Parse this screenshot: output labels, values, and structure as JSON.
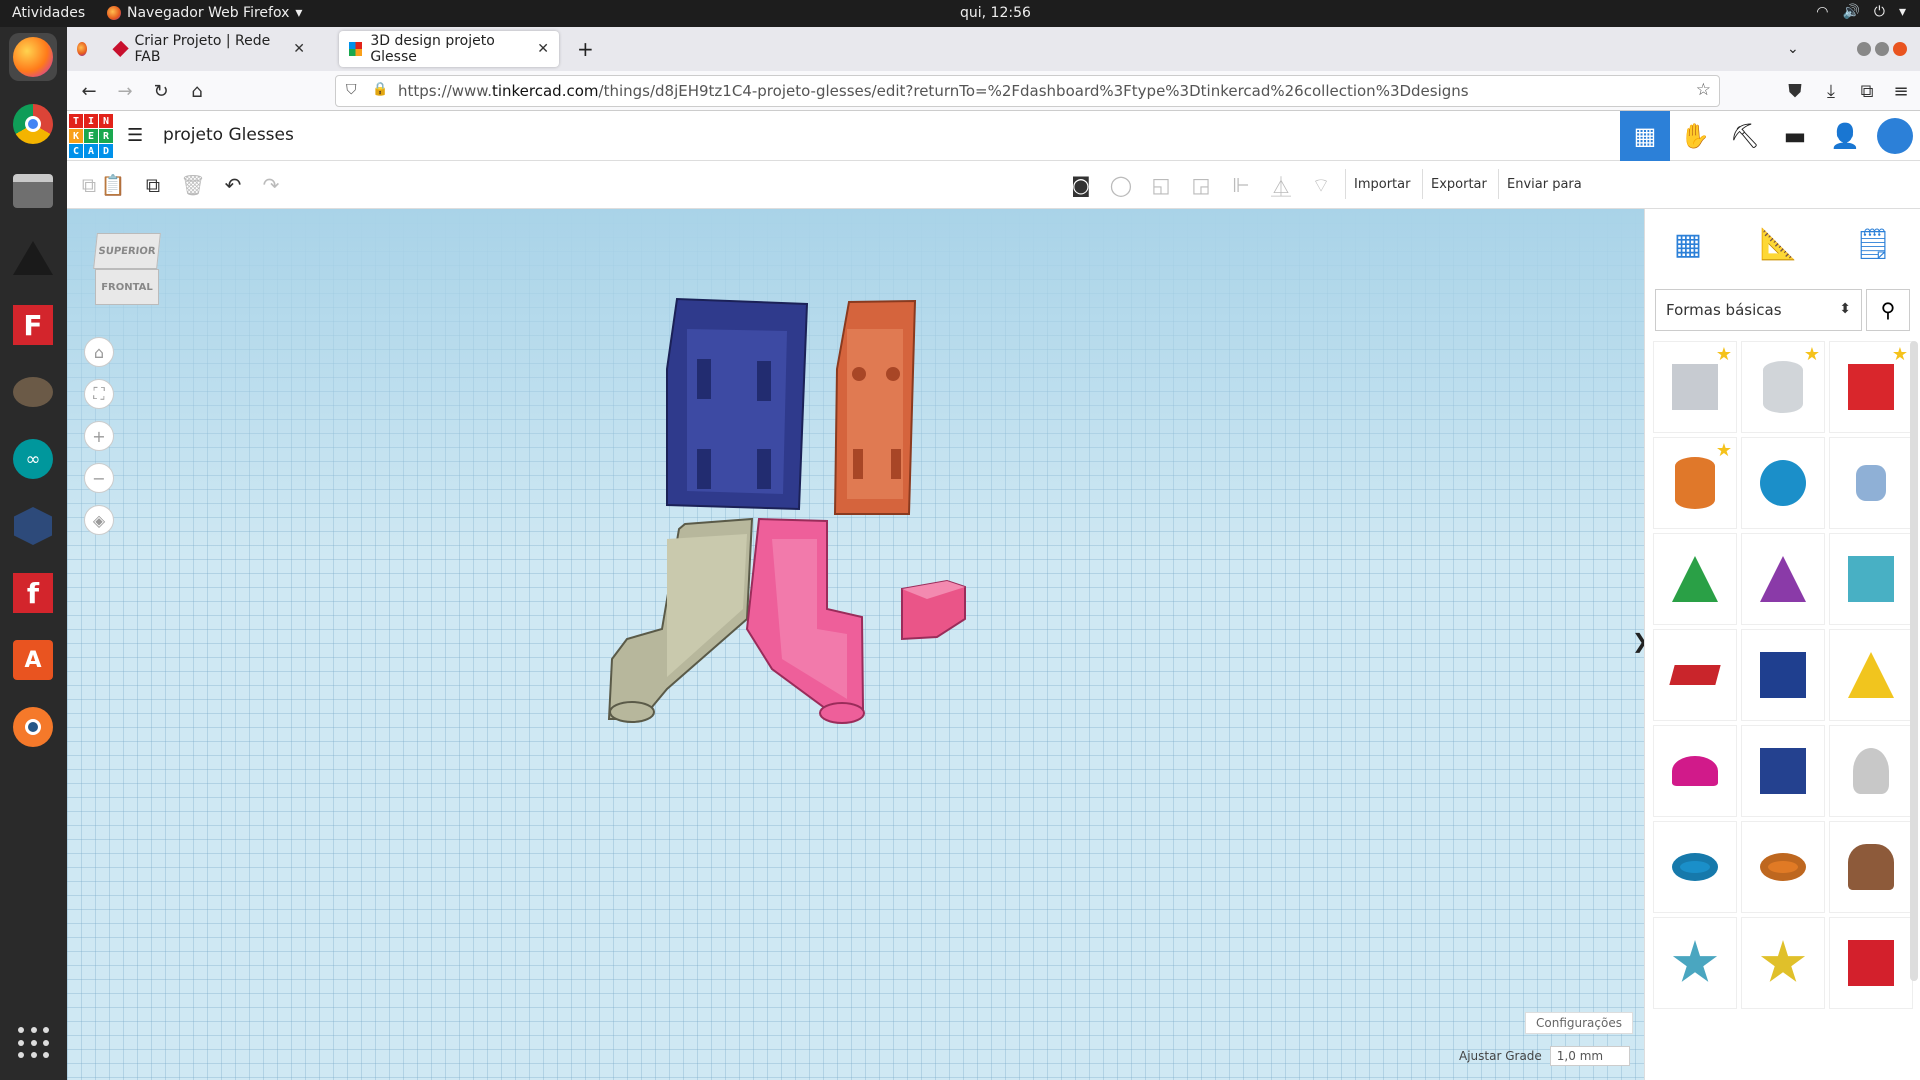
{
  "system": {
    "activities": "Atividades",
    "app_name": "Navegador Web Firefox",
    "clock": "qui, 12:56"
  },
  "browser": {
    "tabs": [
      {
        "label": "Criar Projeto | Rede FAB"
      },
      {
        "label": "3D design projeto Glesse"
      }
    ],
    "url_prefix": "https://www.",
    "url_host": "tinkercad.com",
    "url_path": "/things/d8jEH9tz1C4-projeto-glesses/edit?returnTo=%2Fdashboard%3Ftype%3Dtinkercad%26collection%3Ddesigns"
  },
  "tinkercad": {
    "logo_letters": [
      "TIN",
      "KER",
      "CAD"
    ],
    "project_title": "projeto Glesses",
    "toolbar": {
      "import_label": "Importar",
      "export_label": "Exportar",
      "send_label": "Enviar para"
    },
    "viewcube": {
      "top_label": "SUPERIOR",
      "front_label": "FRONTAL"
    },
    "settings_label": "Configurações",
    "snap_label": "Ajustar Grade",
    "snap_value": "1,0 mm",
    "shapes_category": "Formas básicas",
    "shapes": [
      {
        "name": "box-hole",
        "color": "#b9bec6",
        "starred": true
      },
      {
        "name": "cylinder-hole",
        "color": "#c6cacf",
        "starred": true
      },
      {
        "name": "box",
        "color": "#d9262c",
        "starred": true
      },
      {
        "name": "cylinder",
        "color": "#e0782a",
        "starred": true
      },
      {
        "name": "sphere",
        "color": "#1b8fc9",
        "starred": false
      },
      {
        "name": "scribble",
        "color": "#8fb0d6",
        "starred": false
      },
      {
        "name": "roof",
        "color": "#2aa046",
        "starred": false
      },
      {
        "name": "cone",
        "color": "#8a3aa8",
        "starred": false
      },
      {
        "name": "round-roof",
        "color": "#48b0c4",
        "starred": false
      },
      {
        "name": "text",
        "color": "#c9252b",
        "starred": false
      },
      {
        "name": "wedge",
        "color": "#1f3f8f",
        "starred": false
      },
      {
        "name": "pyramid",
        "color": "#f1c51e",
        "starred": false
      },
      {
        "name": "half-sphere",
        "color": "#d11a8a",
        "starred": false
      },
      {
        "name": "polygon",
        "color": "#24418f",
        "starred": false
      },
      {
        "name": "paraboloid",
        "color": "#c8c8c8",
        "starred": false
      },
      {
        "name": "torus",
        "color": "#1a8fc9",
        "starred": false
      },
      {
        "name": "tube",
        "color": "#e07a25",
        "starred": false
      },
      {
        "name": "heart",
        "color": "#8d5a3a",
        "starred": false
      },
      {
        "name": "star",
        "color": "#4aa6c0",
        "starred": false
      },
      {
        "name": "star-gold",
        "color": "#e0c02a",
        "starred": false
      },
      {
        "name": "icosahedron",
        "color": "#d3202c",
        "starred": false
      }
    ],
    "parts": [
      {
        "name": "navy-housing",
        "color": "#2f3a8c"
      },
      {
        "name": "orange-housing",
        "color": "#d5643d"
      },
      {
        "name": "olive-arm",
        "color": "#b7b79c"
      },
      {
        "name": "pink-arm",
        "color": "#ee5f9a"
      },
      {
        "name": "pink-clip",
        "color": "#ea5588"
      }
    ]
  }
}
